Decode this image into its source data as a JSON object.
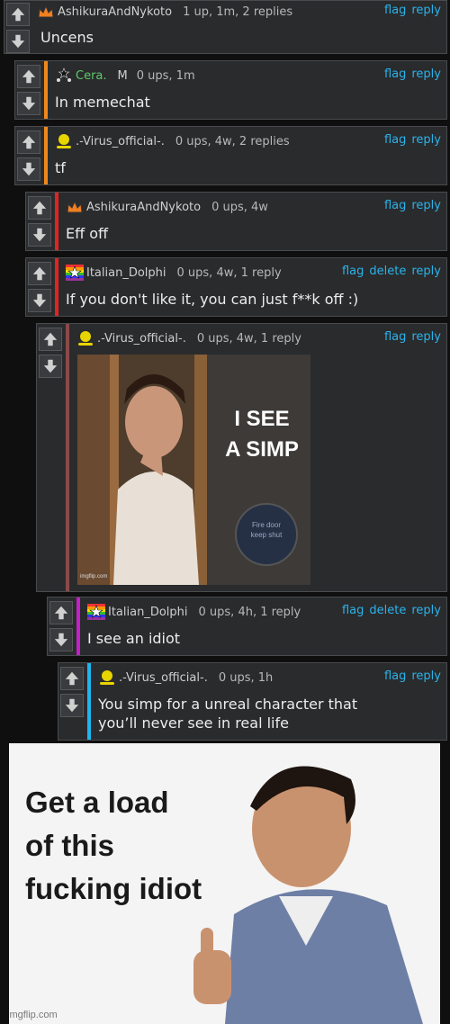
{
  "colors": {
    "link": "#2ab3ea",
    "stripe_orange": "#f0871c",
    "stripe_red": "#e02424",
    "stripe_brown": "#8b4a4a",
    "stripe_magenta": "#c51fc8",
    "stripe_cyan": "#1fb4f0",
    "username_green": "#5cc96a"
  },
  "comments": [
    {
      "user": "AshikuraAndNykoto",
      "meta": "1 up, 1m, 2 replies",
      "text": "Uncens",
      "actions": [
        "flag",
        "reply"
      ]
    },
    {
      "user": "Cera.",
      "badge": "M",
      "meta": "0 ups, 1m",
      "text": "In memechat",
      "actions": [
        "flag",
        "reply"
      ]
    },
    {
      "user": ".-Virus_official-.",
      "meta": "0 ups, 4w, 2 replies",
      "text": "tf",
      "actions": [
        "flag",
        "reply"
      ]
    },
    {
      "user": "AshikuraAndNykoto",
      "meta": "0 ups, 4w",
      "text": "Eff off",
      "actions": [
        "flag",
        "reply"
      ]
    },
    {
      "user": "Italian_Dolphi",
      "meta": "0 ups, 4w, 1 reply",
      "text": "If you don't like it, you can just f**k off :)",
      "actions": [
        "flag",
        "delete",
        "reply"
      ]
    },
    {
      "user": ".-Virus_official-.",
      "meta": "0 ups, 4w, 1 reply",
      "text": "",
      "actions": [
        "flag",
        "reply"
      ]
    },
    {
      "user": "Italian_Dolphi",
      "meta": "0 ups, 4h, 1 reply",
      "text": "I see an idiot",
      "actions": [
        "flag",
        "delete",
        "reply"
      ]
    },
    {
      "user": ".-Virus_official-.",
      "meta": "0 ups, 1h",
      "text": "You simp for a unreal character that you’ll never see in real life",
      "actions": [
        "flag",
        "reply"
      ]
    }
  ],
  "memes": {
    "simp": {
      "caption": "I SEE\nA SIMP",
      "sign": "Fire door\nkeep shut",
      "watermark": "imgflip.com"
    },
    "idiot": {
      "caption": "Get a load\nof this\nfucking idiot",
      "watermark": "imgflip.com"
    }
  }
}
